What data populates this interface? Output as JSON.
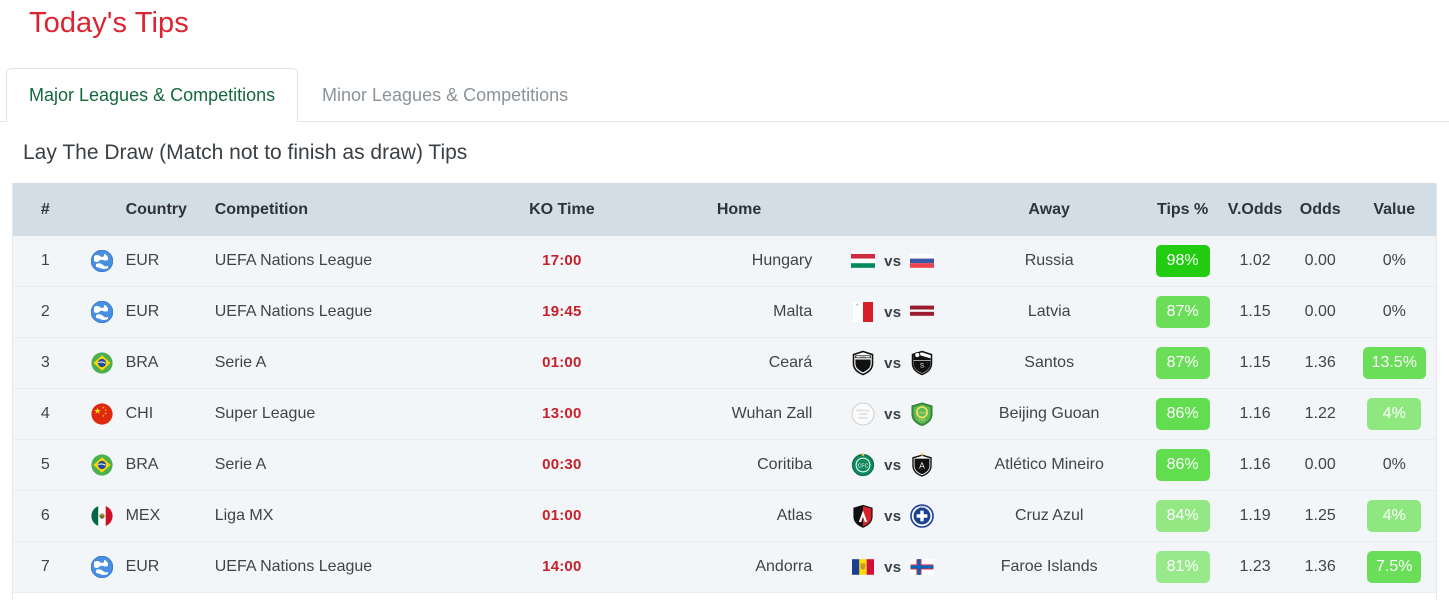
{
  "page": {
    "title": "Today's Tips"
  },
  "tabs": [
    {
      "label": "Major Leagues & Competitions",
      "active": true
    },
    {
      "label": "Minor Leagues & Competitions",
      "active": false
    }
  ],
  "section": {
    "heading": "Lay The Draw (Match not to finish as draw) Tips"
  },
  "table": {
    "columns": [
      "#",
      "Country",
      "Competition",
      "KO Time",
      "Home",
      "Away",
      "Tips %",
      "V.Odds",
      "Odds",
      "Value"
    ],
    "vs_label": "vs",
    "rows": [
      {
        "num": "1",
        "country_flag": "globe-europe-icon",
        "country": "EUR",
        "competition": "UEFA Nations League",
        "ko_time": "17:00",
        "home": "Hungary",
        "home_crest": "hungary-flag",
        "away_crest": "russia-flag",
        "away": "Russia",
        "tips_pct": "98%",
        "tips_color": "#22cc11",
        "v_odds": "1.02",
        "odds": "0.00",
        "value": "0%",
        "value_color": ""
      },
      {
        "num": "2",
        "country_flag": "globe-europe-icon",
        "country": "EUR",
        "competition": "UEFA Nations League",
        "ko_time": "19:45",
        "home": "Malta",
        "home_crest": "malta-flag",
        "away_crest": "latvia-flag",
        "away": "Latvia",
        "tips_pct": "87%",
        "tips_color": "#6ade58",
        "v_odds": "1.15",
        "odds": "0.00",
        "value": "0%",
        "value_color": ""
      },
      {
        "num": "3",
        "country_flag": "brazil-flag-icon",
        "country": "BRA",
        "competition": "Serie A",
        "ko_time": "01:00",
        "home": "Ceará",
        "home_crest": "ceara-crest",
        "away_crest": "santos-crest",
        "away": "Santos",
        "tips_pct": "87%",
        "tips_color": "#6ade58",
        "v_odds": "1.15",
        "odds": "1.36",
        "value": "13.5%",
        "value_color": "#6ade58"
      },
      {
        "num": "4",
        "country_flag": "china-flag-icon",
        "country": "CHI",
        "competition": "Super League",
        "ko_time": "13:00",
        "home": "Wuhan Zall",
        "home_crest": "official-logo-soon",
        "away_crest": "beijing-guoan-crest",
        "away": "Beijing Guoan",
        "tips_pct": "86%",
        "tips_color": "#63dd50",
        "v_odds": "1.16",
        "odds": "1.22",
        "value": "4%",
        "value_color": "#8fe87f"
      },
      {
        "num": "5",
        "country_flag": "brazil-flag-icon",
        "country": "BRA",
        "competition": "Serie A",
        "ko_time": "00:30",
        "home": "Coritiba",
        "home_crest": "coritiba-crest",
        "away_crest": "atletico-mineiro-crest",
        "away": "Atlético Mineiro",
        "tips_pct": "86%",
        "tips_color": "#63dd50",
        "v_odds": "1.16",
        "odds": "0.00",
        "value": "0%",
        "value_color": ""
      },
      {
        "num": "6",
        "country_flag": "mexico-flag-icon",
        "country": "MEX",
        "competition": "Liga MX",
        "ko_time": "01:00",
        "home": "Atlas",
        "home_crest": "atlas-crest",
        "away_crest": "cruz-azul-crest",
        "away": "Cruz Azul",
        "tips_pct": "84%",
        "tips_color": "#93e883",
        "v_odds": "1.19",
        "odds": "1.25",
        "value": "4%",
        "value_color": "#8fe87f"
      },
      {
        "num": "7",
        "country_flag": "globe-europe-icon",
        "country": "EUR",
        "competition": "UEFA Nations League",
        "ko_time": "14:00",
        "home": "Andorra",
        "home_crest": "andorra-flag",
        "away_crest": "faroe-islands-flag",
        "away": "Faroe Islands",
        "tips_pct": "81%",
        "tips_color": "#97e98a",
        "v_odds": "1.23",
        "odds": "1.36",
        "value": "7.5%",
        "value_color": "#6ade58"
      }
    ]
  },
  "colors": {
    "title_red": "#dc2430",
    "active_tab_green": "#14693c",
    "header_bg": "#d2dde5",
    "row_bg": "#f3f6f8",
    "ko_time_red": "#c8202b"
  }
}
